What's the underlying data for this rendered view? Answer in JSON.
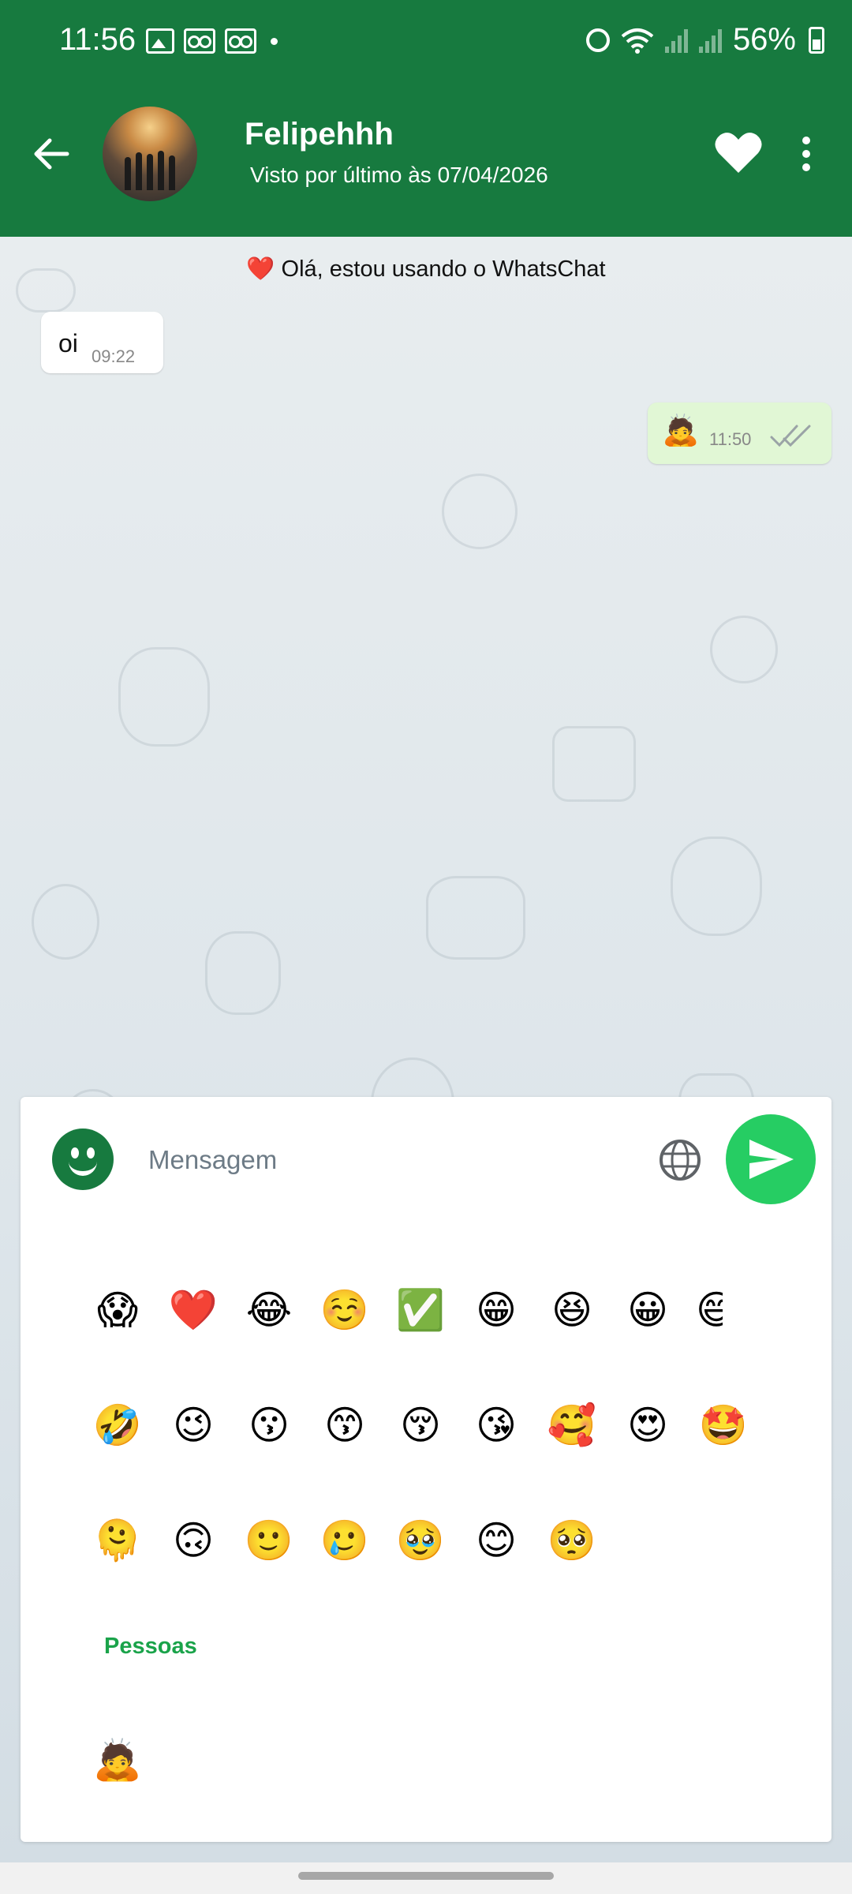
{
  "status_bar": {
    "time": "11:56",
    "battery": "56%",
    "icons": [
      "gallery-icon",
      "voicemail-icon",
      "voicemail-icon",
      "dot-icon",
      "alarm-icon",
      "wifi-icon",
      "signal-icon",
      "signal-icon",
      "battery-icon"
    ]
  },
  "header": {
    "contact_name": "Felipehhh",
    "last_seen": "Visto por último às 07/04/2026",
    "color": "#177a3f"
  },
  "chat": {
    "system_message": "❤️ Olá, estou usando o WhatsChat",
    "messages": [
      {
        "direction": "in",
        "text": "oi",
        "time": "09:22"
      },
      {
        "direction": "out",
        "text": "🙇",
        "time": "11:50",
        "status": "read"
      }
    ]
  },
  "composer": {
    "placeholder": "Mensagem",
    "send_color": "#26cd63"
  },
  "emoji_panel": {
    "recent_rows": [
      [
        "😱",
        "❤️",
        "😂",
        "☺️",
        "✅",
        "😁",
        "😆",
        "😀",
        "😄"
      ],
      [
        "🤣",
        "😉",
        "😗",
        "😙",
        "😚",
        "😘",
        "🥰",
        "😍",
        "🤩"
      ],
      [
        "🫠",
        "🙃",
        "🙂",
        "🥲",
        "🥹",
        "😊",
        "🥺"
      ]
    ],
    "section_title": "Pessoas",
    "section_emojis": [
      "🙇"
    ]
  }
}
